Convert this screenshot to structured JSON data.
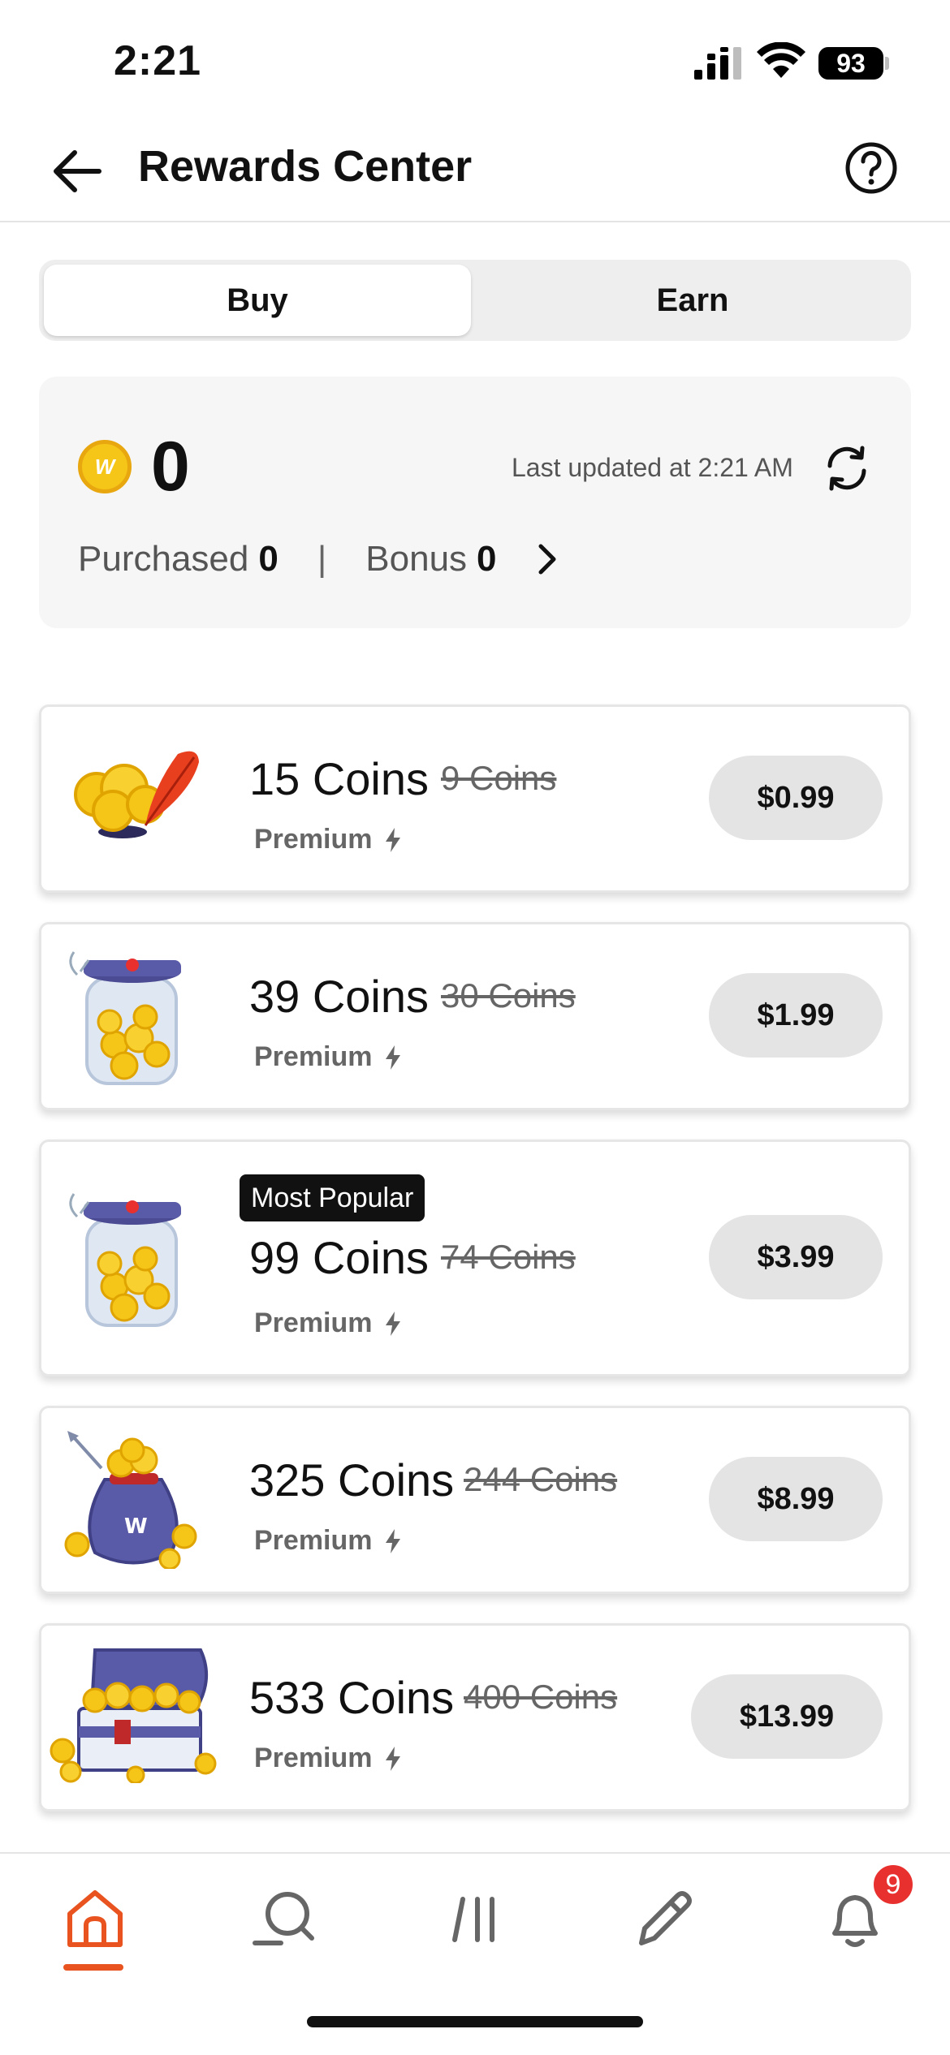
{
  "status_bar": {
    "time": "2:21",
    "battery": "93"
  },
  "header": {
    "title": "Rewards Center"
  },
  "tabs": [
    {
      "label": "Buy",
      "active": true
    },
    {
      "label": "Earn",
      "active": false
    }
  ],
  "balance": {
    "amount": "0",
    "last_updated": "Last updated at 2:21 AM",
    "purchased_label": "Purchased",
    "purchased_value": "0",
    "separator": "|",
    "bonus_label": "Bonus",
    "bonus_value": "0"
  },
  "packages": [
    {
      "coins": "15 Coins",
      "old_coins": "9 Coins",
      "tier": "Premium",
      "price": "$0.99",
      "badge": "",
      "icon": "coins-quill-icon"
    },
    {
      "coins": "39 Coins",
      "old_coins": "30 Coins",
      "tier": "Premium",
      "price": "$1.99",
      "badge": "",
      "icon": "coin-jar-icon"
    },
    {
      "coins": "99 Coins",
      "old_coins": "74 Coins",
      "tier": "Premium",
      "price": "$3.99",
      "badge": "Most Popular",
      "icon": "coin-jar-icon"
    },
    {
      "coins": "325 Coins",
      "old_coins": "244 Coins",
      "tier": "Premium",
      "price": "$8.99",
      "badge": "",
      "icon": "coin-bag-icon"
    },
    {
      "coins": "533 Coins",
      "old_coins": "400 Coins",
      "tier": "Premium",
      "price": "$13.99",
      "badge": "",
      "icon": "treasure-chest-icon"
    }
  ],
  "bottom_nav": {
    "items": [
      {
        "name": "home",
        "icon": "home-icon",
        "active": true
      },
      {
        "name": "search",
        "icon": "search-icon",
        "active": false
      },
      {
        "name": "library",
        "icon": "library-icon",
        "active": false
      },
      {
        "name": "write",
        "icon": "pencil-icon",
        "active": false
      },
      {
        "name": "notifications",
        "icon": "bell-icon",
        "active": false
      }
    ],
    "notification_count": "9"
  },
  "colors": {
    "accent": "#e8531f",
    "coin": "#f5c518",
    "badge": "#e8312f",
    "price_pill": "#e4e4e4"
  }
}
